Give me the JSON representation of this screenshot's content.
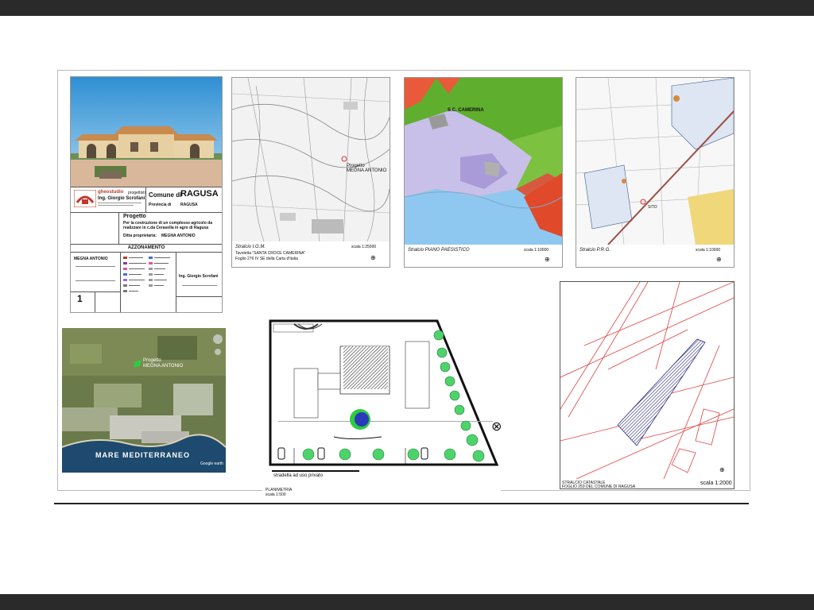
{
  "title_block": {
    "firm": "gheostudio",
    "firm_role": "progettisti",
    "engineer": "Ing. Giorgio Scrofani",
    "comune_label": "Comune di",
    "comune_name": "RAGUSA",
    "provincia_label": "Provincia di",
    "provincia_name": "RAGUSA",
    "progetto_label": "Progetto",
    "progetto_line1": "Per la costruzione di un complesso agricolo da",
    "progetto_line2": "realizzare in c.da Cerasella in agro di Ragusa",
    "ditta_label": "Ditta proprietaria:",
    "ditta_name": "MEGNA ANTONIO",
    "section_title": "AZZONAMENTO",
    "owner_sign": "MEGNA ANTONIO",
    "tavola_number": "1",
    "engineer_sign": "Ing. Giorgio Scrofani"
  },
  "maps": {
    "igm_caption": "Stralcio I.G.M.",
    "igm_sub1": "Tavoletta \"SANTA CROCE CAMERINA\"",
    "igm_sub2": "Foglio 276 IV SE della Carta d'Italia",
    "igm_scale": "scala 1:25000",
    "igm_label_line1": "Progetto",
    "igm_label_line2": "MEGNA ANTONIO",
    "paes_caption": "Stralcio PIANO PAESISTICO",
    "paes_scale": "scala 1:10000",
    "paes_place": "S.C. CAMERINA",
    "prg_caption": "Stralcio P.R.G.",
    "prg_scale": "scala 1:10000",
    "prg_site": "SITO"
  },
  "aerial": {
    "label_line1": "Progetto",
    "label_line2": "MEGNA ANTONIO",
    "sea_label": "MARE MEDITERRANEO",
    "brand": "Google earth"
  },
  "planimetria": {
    "road_label": "stradella ad uso privato",
    "caption": "PLANIMETRIA",
    "scale": "scala 1:500"
  },
  "catastale": {
    "caption_line1": "STRALCIO CATASTALE",
    "caption_line2": "FOGLIO 259 DEL COMUNE DI RAGUSA",
    "scale": "scala 1:2000"
  }
}
